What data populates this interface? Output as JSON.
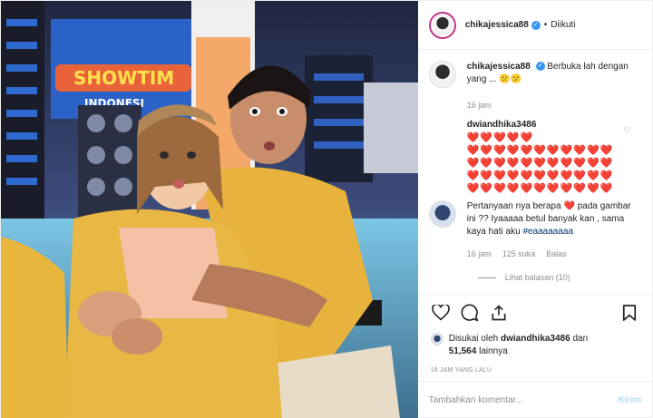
{
  "header": {
    "username": "chikajessica88",
    "verified_mark": "✓",
    "separator": "•",
    "follow_status": "Diikuti"
  },
  "photo": {
    "stage_sign": "SHOWTIM",
    "stage_sign_sub": "INDONESI"
  },
  "caption": {
    "username": "chikajessica88",
    "text": "Berbuka lah dengan yang ... 😕😕",
    "time": "16 jam"
  },
  "comment1": {
    "username": "dwiandhika3486",
    "hearts": "❤️❤️❤️❤️❤️\n❤️❤️❤️❤️❤️❤️❤️❤️❤️❤️❤️\n❤️❤️❤️❤️❤️❤️❤️❤️❤️❤️❤️\n❤️❤️❤️❤️❤️❤️❤️❤️❤️❤️❤️\n❤️❤️❤️❤️❤️❤️❤️❤️❤️❤️❤️",
    "text": "Pertanyaan nya berapa ❤️ pada gambar ini ?? Iyaaaaa betul banyak kan , sama kaya hati aku",
    "hashtag": "#eaaaaaaaa",
    "time": "16 jam",
    "likes": "125 suka",
    "reply": "Balas",
    "view_replies": "Lihat balasan (10)"
  },
  "likes": {
    "liked_by_prefix": "Disukai oleh",
    "liked_by_user": "dwiandhika3486",
    "and": "dan",
    "count": "51,564",
    "others": "lainnya"
  },
  "timestamp": "16 JAM YANG LALU",
  "add_comment": {
    "placeholder": "Tambahkan komentar...",
    "post_label": "Kirim"
  },
  "icons": {
    "like": "heart-icon",
    "comment": "comment-icon",
    "share": "share-icon",
    "save": "bookmark-icon",
    "verified": "verified-badge-icon"
  },
  "colors": {
    "accent_blue": "#3897f0",
    "heart_red": "#ed4956",
    "muted": "#8e8e8e",
    "post_button_disabled": "#b2dffc",
    "hashtag": "#003569"
  }
}
